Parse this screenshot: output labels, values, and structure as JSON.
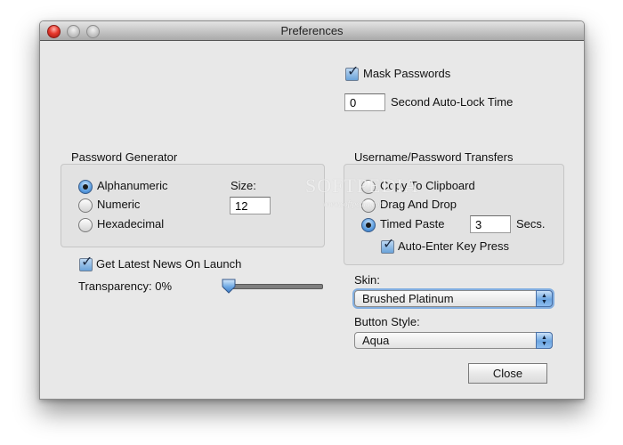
{
  "window": {
    "title": "Preferences",
    "traffic_lights": [
      "close",
      "minimize",
      "zoom"
    ]
  },
  "security": {
    "mask_passwords": {
      "label": "Mask Passwords",
      "checked": true
    },
    "auto_lock": {
      "value": "0",
      "label": "Second Auto-Lock Time"
    }
  },
  "password_generator": {
    "title": "Password Generator",
    "options": [
      {
        "label": "Alphanumeric",
        "selected": true
      },
      {
        "label": "Numeric",
        "selected": false
      },
      {
        "label": "Hexadecimal",
        "selected": false
      }
    ],
    "size_label": "Size:",
    "size_value": "12"
  },
  "transfers": {
    "title": "Username/Password Transfers",
    "options": [
      {
        "label": "Copy To Clipboard",
        "selected": false
      },
      {
        "label": "Drag And Drop",
        "selected": false
      },
      {
        "label": "Timed Paste",
        "selected": true
      }
    ],
    "timed_paste_value": "3",
    "secs_label": "Secs.",
    "auto_enter": {
      "label": "Auto-Enter Key Press",
      "checked": true
    }
  },
  "news": {
    "label": "Get Latest News On Launch",
    "checked": true
  },
  "transparency": {
    "label": "Transparency: 0%",
    "percent": 0
  },
  "skin": {
    "label": "Skin:",
    "selected": "Brushed Platinum"
  },
  "button_style": {
    "label": "Button Style:",
    "selected": "Aqua"
  },
  "actions": {
    "close_label": "Close"
  },
  "watermark": {
    "text": "SOFTPEDIA",
    "url": "www.softpedia.com"
  },
  "colors": {
    "accent": "#5b9de0",
    "close_light": "#e7392d",
    "window_bg": "#e8e8e8"
  }
}
